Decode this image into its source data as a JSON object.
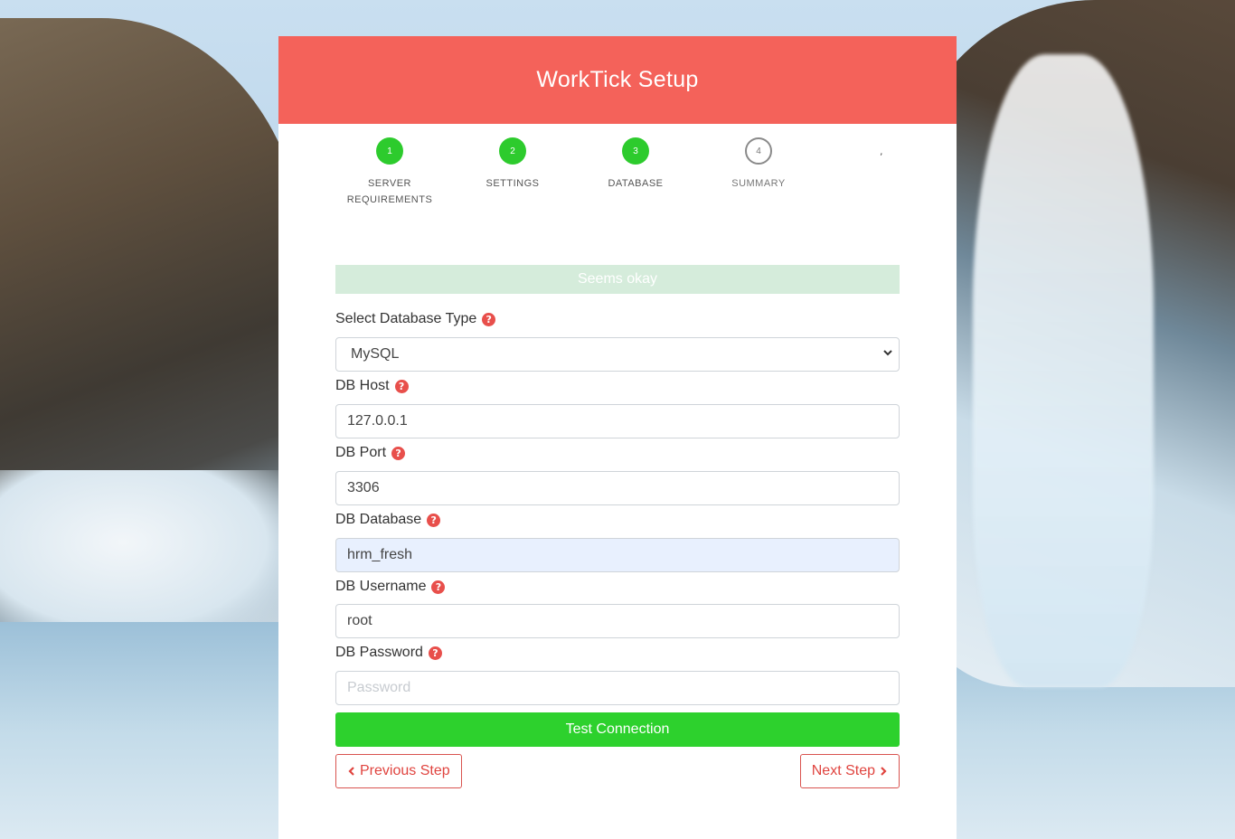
{
  "header": {
    "title": "WorkTick Setup"
  },
  "steps": [
    {
      "number": "1",
      "label_line1": "SERVER",
      "label_line2": "REQUIREMENTS",
      "state": "done"
    },
    {
      "number": "2",
      "label_line1": "SETTINGS",
      "label_line2": "",
      "state": "done"
    },
    {
      "number": "3",
      "label_line1": "DATABASE",
      "label_line2": "",
      "state": "done"
    },
    {
      "number": "4",
      "label_line1": "SUMMARY",
      "label_line2": "",
      "state": "pending"
    }
  ],
  "steps_trailing": ",",
  "alert": {
    "text": "Seems okay"
  },
  "form": {
    "db_type": {
      "label": "Select Database Type",
      "value": "MySQL"
    },
    "db_host": {
      "label": "DB Host",
      "value": "127.0.0.1"
    },
    "db_port": {
      "label": "DB Port",
      "value": "3306"
    },
    "db_database": {
      "label": "DB Database",
      "value": "hrm_fresh"
    },
    "db_username": {
      "label": "DB Username",
      "value": "root"
    },
    "db_password": {
      "label": "DB Password",
      "value": "",
      "placeholder": "Password"
    }
  },
  "buttons": {
    "test_connection": "Test Connection",
    "previous": "Previous Step",
    "next": "Next Step"
  },
  "colors": {
    "header": "#f4625a",
    "step_done": "#2dcb2d",
    "test_button": "#2dd12d",
    "outline_button": "#d9534f",
    "help_icon": "#e84f4b",
    "alert_bg": "#d5ecdb"
  }
}
